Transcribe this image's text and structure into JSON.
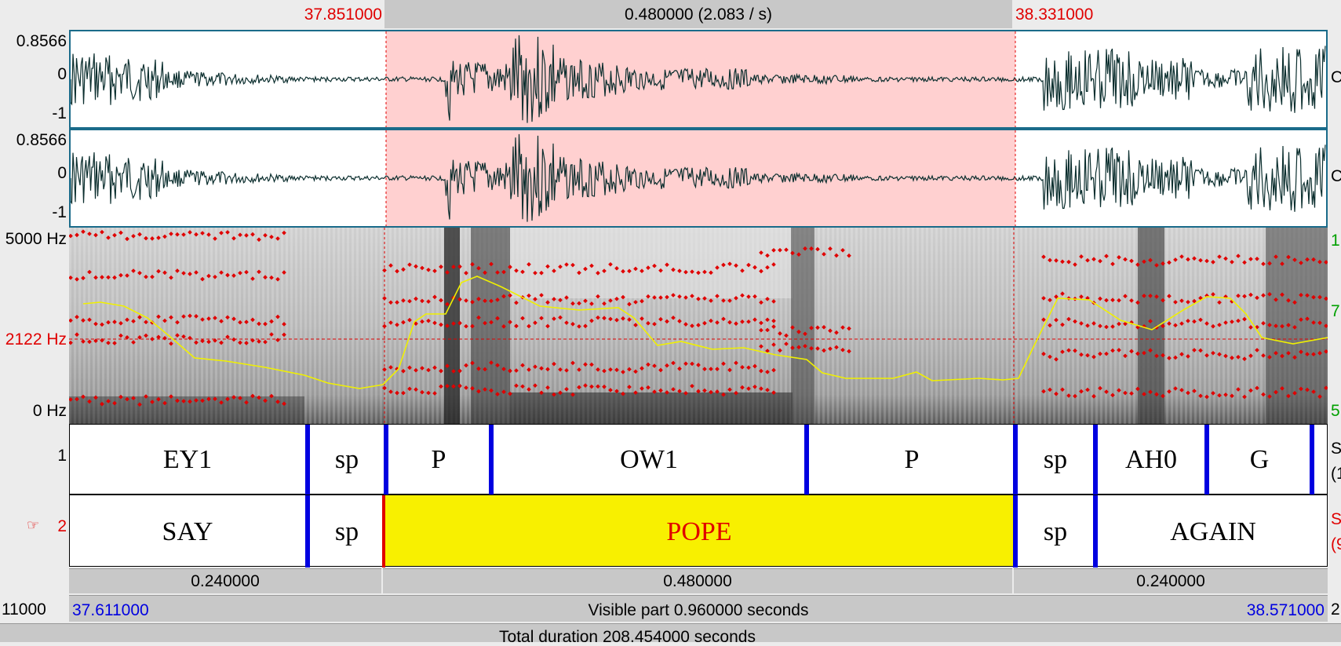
{
  "selection": {
    "start": "37.851000",
    "end": "38.331000",
    "duration": "0.480000 (2.083 / s)"
  },
  "channels": [
    {
      "max": "0.8566",
      "zero": "0",
      "min": "-1",
      "right_label": "C"
    },
    {
      "max": "0.8566",
      "zero": "0",
      "min": "-1",
      "right_label": "C"
    }
  ],
  "spectrogram": {
    "top_freq": "5000 Hz",
    "cursor_freq": "2122 Hz",
    "bottom_freq": "0 Hz",
    "right_labels": [
      "1",
      "7",
      "5"
    ]
  },
  "tiers": [
    {
      "number": "1",
      "right_label": "S\n(1",
      "intervals": [
        "EY1",
        "sp",
        "P",
        "OW1",
        "P",
        "sp",
        "AH0",
        "G"
      ]
    },
    {
      "number": "2",
      "pointer": "☞",
      "right_label": "S\n(9",
      "intervals": [
        "SAY",
        "sp",
        "POPE",
        "sp",
        "AGAIN"
      ]
    }
  ],
  "durations": {
    "left": "0.240000",
    "selection": "0.480000",
    "right": "0.240000"
  },
  "window": {
    "left_cut": "11000",
    "visible_start": "37.611000",
    "visible_text": "Visible part 0.960000 seconds",
    "visible_end": "38.571000",
    "right_cut": "2",
    "total_text": "Total duration 208.454000 seconds"
  },
  "colors": {
    "selection_fill": "#ffd0d0",
    "selected_interval": "#f8f000",
    "boundary": "#0000e0",
    "formant": "#e00000",
    "pitch": "#f0f000"
  }
}
